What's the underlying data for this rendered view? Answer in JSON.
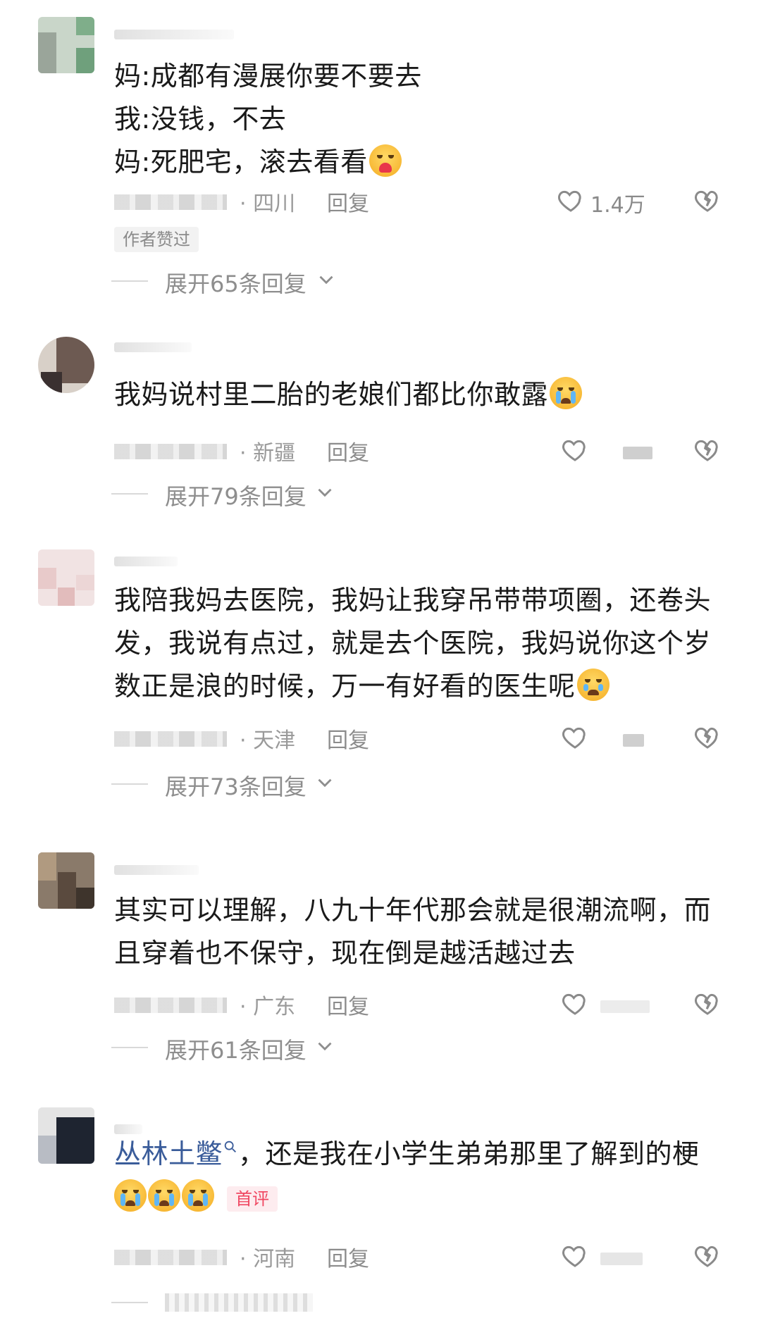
{
  "comments": [
    {
      "lines": [
        "妈:成都有漫展你要不要去",
        "我:没钱，不去",
        "妈:死肥宅，滚去看看"
      ],
      "emoji": "heart-face-emoji",
      "location": "· 四川",
      "reply": "回复",
      "likes": "1.4万",
      "badge": "作者赞过",
      "expand": "展开65条回复"
    },
    {
      "lines": [
        "我妈说村里二胎的老娘们都比你敢露"
      ],
      "emoji": "crying-face-emoji",
      "location": "· 新疆",
      "reply": "回复",
      "likes": "",
      "expand": "展开79条回复"
    },
    {
      "lines": [
        "我陪我妈去医院，我妈让我穿吊带带项圈，还卷头",
        "发，我说有点过，就是去个医院，我妈说你这个岁",
        "数正是浪的时候，万一有好看的医生呢"
      ],
      "emoji": "holding-tears-emoji",
      "location": "· 天津",
      "reply": "回复",
      "likes": "",
      "expand": "展开73条回复"
    },
    {
      "lines": [
        "其实可以理解，八九十年代那会就是很潮流啊，而",
        "且穿着也不保守，现在倒是越活越过去"
      ],
      "location": "· 广东",
      "reply": "回复",
      "likes": "",
      "expand": "展开61条回复"
    },
    {
      "mention": "丛林土鳖",
      "lines": [
        "，还是我在小学生弟弟那里了解到的梗"
      ],
      "emoji": "crying-face-emoji",
      "badge": "首评",
      "location": "· 河南",
      "reply": "回复",
      "likes": ""
    }
  ],
  "icons": {
    "like": "heart-outline-icon",
    "dislike": "broken-heart-icon",
    "expand": "chevron-down-icon",
    "mention": "search-icon"
  }
}
